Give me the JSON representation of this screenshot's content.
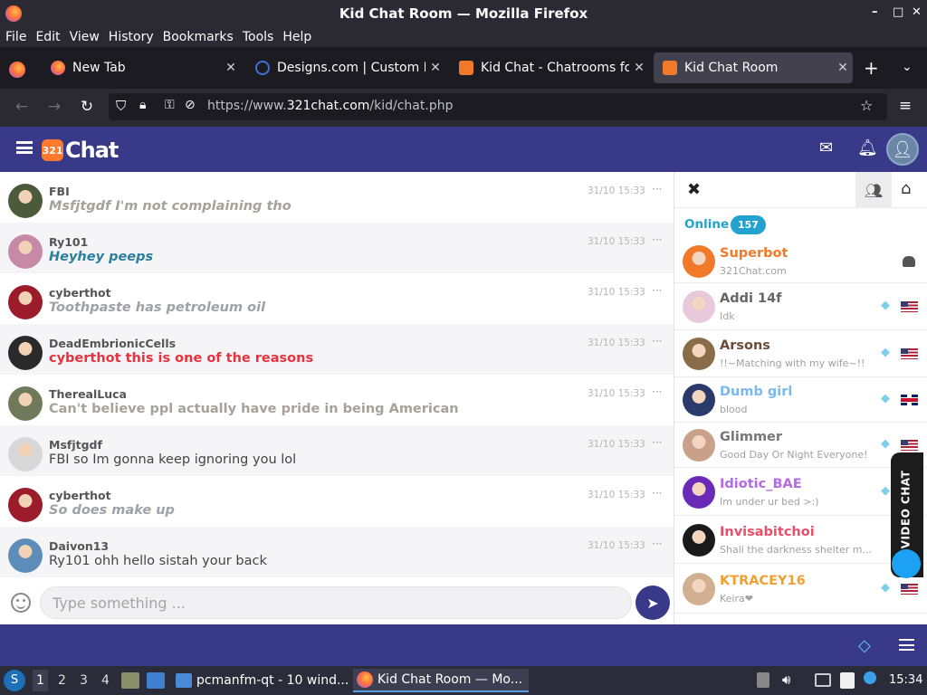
{
  "window": {
    "title": "Kid Chat Room — Mozilla Firefox",
    "minimize": "–",
    "maximize": "□",
    "close": "✕"
  },
  "menu": [
    "File",
    "Edit",
    "View",
    "History",
    "Bookmarks",
    "Tools",
    "Help"
  ],
  "tabs": [
    {
      "label": "New Tab",
      "active": false
    },
    {
      "label": "Designs.com | Custom De",
      "active": false
    },
    {
      "label": "Kid Chat - Chatrooms for",
      "active": false
    },
    {
      "label": "Kid Chat Room",
      "active": true
    }
  ],
  "address": {
    "prefix": "https://www.",
    "domain": "321chat.com",
    "path": "/kid/chat.php"
  },
  "site": {
    "logo_badge": "321",
    "logo_text": "Chat"
  },
  "messages": [
    {
      "user": "FBI",
      "text": "Msfjtgdf I'm not complaining tho",
      "time": "31/10 15:33",
      "more": "···",
      "color": "#a7a19b",
      "italic": true,
      "avatar_color": "#4a5a3a"
    },
    {
      "user": "Ry101",
      "text": "Heyhey peeps",
      "time": "31/10 15:33",
      "more": "···",
      "color": "#2a7f9f",
      "italic": true,
      "avatar_color": "#c78aa6"
    },
    {
      "user": "cyberthot",
      "text": "Toothpaste has petroleum oil",
      "time": "31/10 15:33",
      "more": "···",
      "color": "#9ea1a6",
      "italic": true,
      "avatar_color": "#9c1c2b"
    },
    {
      "user": "DeadEmbrionicCells",
      "text": "cyberthot this is one of the reasons",
      "time": "31/10 15:33",
      "more": "···",
      "color": "#e8323f",
      "italic": false,
      "avatar_color": "#2a2a2a"
    },
    {
      "user": "TherealLuca",
      "text": "Can't believe ppl actually have pride in being American",
      "time": "31/10 15:33",
      "more": "···",
      "color": "#a7a19b",
      "italic": false,
      "avatar_color": "#6f7a5a"
    },
    {
      "user": "Msfjtgdf",
      "text": "FBI so Im gonna keep ignoring you lol",
      "time": "31/10 15:33",
      "more": "···",
      "color": "#444444",
      "italic": false,
      "avatar_color": "#d8d8d8"
    },
    {
      "user": "cyberthot",
      "text": "So does make up",
      "time": "31/10 15:33",
      "more": "···",
      "color": "#9ea1a6",
      "italic": true,
      "avatar_color": "#9c1c2b"
    },
    {
      "user": "Daivon13",
      "text": "Ry101 ohh hello sistah your back",
      "time": "31/10 15:33",
      "more": "···",
      "color": "#444444",
      "italic": false,
      "avatar_color": "#5b8db8"
    }
  ],
  "input": {
    "placeholder": "Type something ..."
  },
  "sidebar": {
    "online_label": "Online",
    "online_count": "157",
    "users": [
      {
        "name": "Superbot",
        "status": "321Chat.com",
        "name_color": "#f07a2a",
        "avatar_color": "#f07a2a",
        "gem": false,
        "flag": "android"
      },
      {
        "name": "Addi 14f",
        "status": "Idk",
        "name_color": "#666666",
        "avatar_color": "#e8c9dc",
        "gem": true,
        "flag": "us"
      },
      {
        "name": "Arsons",
        "status": "!!~Matching with my wife~!!",
        "name_color": "#6b4a3a",
        "avatar_color": "#8a6b4a",
        "gem": true,
        "flag": "us"
      },
      {
        "name": "Dumb girl",
        "status": "blood",
        "name_color": "#7ab8f0",
        "avatar_color": "#2a3a6a",
        "gem": true,
        "flag": "uk"
      },
      {
        "name": "Glimmer",
        "status": "Good Day Or Night Everyone!",
        "name_color": "#777777",
        "avatar_color": "#c9a08a",
        "gem": true,
        "flag": "us"
      },
      {
        "name": "Idiotic_BAE",
        "status": "Im under ur bed >:)",
        "name_color": "#b46ae6",
        "avatar_color": "#6a2ab8",
        "gem": true,
        "flag": "none"
      },
      {
        "name": "Invisabitchoi",
        "status": "Shall the darkness shelter m...",
        "name_color": "#e8506a",
        "avatar_color": "#1a1a1a",
        "gem": false,
        "flag": "none"
      },
      {
        "name": "KTRACEY16",
        "status": "Keira❤",
        "name_color": "#f0a030",
        "avatar_color": "#d0b090",
        "gem": true,
        "flag": "us"
      }
    ]
  },
  "video_chat": {
    "label": "VIDEO CHAT"
  },
  "taskbar": {
    "workspaces": [
      "1",
      "2",
      "3",
      "4"
    ],
    "tasks": [
      "pcmanfm-qt - 10 wind...",
      "Kid Chat Room — Mo..."
    ],
    "clock": "15:34"
  },
  "colors": {
    "site_header": "#383a89",
    "accent": "#22a3cf"
  }
}
